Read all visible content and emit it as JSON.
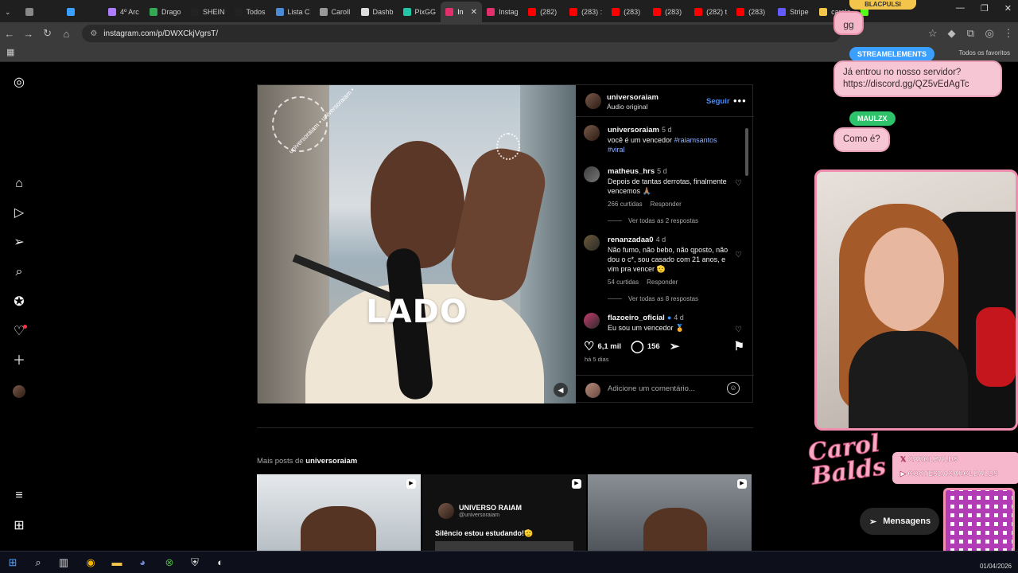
{
  "browser": {
    "tabs": [
      {
        "label": "",
        "color": "#888888"
      },
      {
        "label": "",
        "color": "#3aa0ff"
      },
      {
        "label": "4º Arc",
        "color": "#b07cff"
      },
      {
        "label": "Drago",
        "color": "#34a853"
      },
      {
        "label": "SHEIN",
        "color": "#222222"
      },
      {
        "label": "Todos",
        "color": "#222222"
      },
      {
        "label": "Lista C",
        "color": "#4b8bd6"
      },
      {
        "label": "CarolI",
        "color": "#999999"
      },
      {
        "label": "Dashb",
        "color": "#dddddd"
      },
      {
        "label": "PixGG",
        "color": "#22c7a8"
      },
      {
        "label": "In",
        "color": "#e1306c",
        "active": true
      },
      {
        "label": "Instag",
        "color": "#e1306c"
      },
      {
        "label": "(282)",
        "color": "#ff0000"
      },
      {
        "label": "(283) :",
        "color": "#ff0000"
      },
      {
        "label": "(283)",
        "color": "#ff0000"
      },
      {
        "label": "(283)",
        "color": "#ff0000"
      },
      {
        "label": "(282) t",
        "color": "#ff0000"
      },
      {
        "label": "(283)",
        "color": "#ff0000"
      },
      {
        "label": "Stripe",
        "color": "#635bff"
      },
      {
        "label": "carole",
        "color": "#f4c54b"
      },
      {
        "label": "",
        "color": "#53fc18"
      }
    ],
    "url": "instagram.com/p/DWXCkjVgrsT/",
    "favorites_label": "Todos os favoritos"
  },
  "post": {
    "author": "universoraiam",
    "audio": "Áudio original",
    "follow_label": "Seguir",
    "more": "•••",
    "overlay_word": "LADO",
    "watermark": "universoraiam • universoraiam •",
    "caption": {
      "user": "universoraiam",
      "when": "5 d",
      "text": "você é um vencedor",
      "tags": "#raiamsantos #viral"
    },
    "comments": [
      {
        "user": "matheus_hrs",
        "when": "5 d",
        "text": "Depois de tantas derrotas, finalmente vencemos 🙏🏽",
        "likes": "266 curtidas",
        "reply": "Responder",
        "view_replies": "Ver todas as 2 respostas"
      },
      {
        "user": "renanzadaa0",
        "when": "4 d",
        "text": "Não fumo, não bebo, não qposto, não dou o c*, sou casado com 21 anos, e vim pra vencer 🫡",
        "likes": "54 curtidas",
        "reply": "Responder",
        "view_replies": "Ver todas as 8 respostas"
      },
      {
        "user": "flazoeiro_oficial",
        "when": "4 d",
        "text": "Eu sou um vencedor 🏅"
      }
    ],
    "likes": "6,1 mil",
    "comments_count": "156",
    "date": "há 5 dias",
    "add_comment_placeholder": "Adicione um comentário..."
  },
  "more_posts": {
    "prefix": "Mais posts de",
    "user": "universoraiam",
    "items": [
      {
        "title": ""
      },
      {
        "title": "UNIVERSO RAIAM",
        "handle": "@universoraiam",
        "caption": "Silêncio estou estudando!🫡"
      },
      {
        "title": ""
      }
    ]
  },
  "overlay": {
    "top_badge": "BLACPULSI",
    "gg": "gg",
    "streamelements": "STREAMELEMENTS",
    "chat1": "Já entrou no nosso servidor? https://discord.gg/QZ5vEdAgTc",
    "user2": "MAULZX",
    "chat2": "Como é?",
    "brand_logo": "Carol Balds",
    "social_x": "CAROLBALDS",
    "social_yt": "CORTESDACAROLBALDS"
  },
  "messages_label": "Mensagens",
  "clock": "01/04/2026",
  "colors": {
    "accent_link": "#4a8df8",
    "tag": "#8fb1ff",
    "overlay_pink": "#f08eb0"
  }
}
